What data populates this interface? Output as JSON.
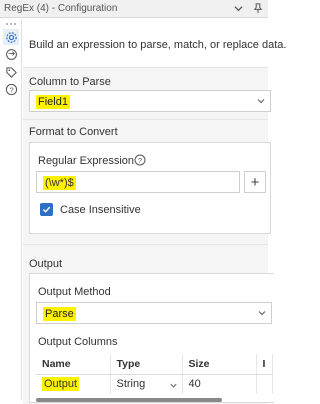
{
  "window": {
    "title": "RegEx (4) - Configuration",
    "icons": [
      "chevron-down-icon",
      "pin-icon"
    ]
  },
  "sidebar": {
    "icons": [
      "gear-icon",
      "arrows-icon",
      "tag-icon",
      "help-icon"
    ]
  },
  "intro_text": "Build an expression to parse, match, or replace data.",
  "column_to_parse": {
    "title": "Column to Parse",
    "value": "Field1"
  },
  "format_to_convert": {
    "title": "Format to Convert",
    "regex_label": "Regular Expression",
    "regex_value": "(\\w*)$",
    "add_label": "+",
    "case_insensitive_label": "Case Insensitive",
    "case_insensitive": true
  },
  "output": {
    "title": "Output",
    "method_label": "Output Method",
    "method_value": "Parse",
    "columns_label": "Output Columns",
    "table": {
      "headers": [
        "Name",
        "Type",
        "Size",
        "I"
      ],
      "rows": [
        {
          "name": "Output",
          "type": "String",
          "size": "40"
        }
      ]
    }
  },
  "colors": {
    "highlight": "#fff200",
    "accent": "#2d6fc4"
  }
}
